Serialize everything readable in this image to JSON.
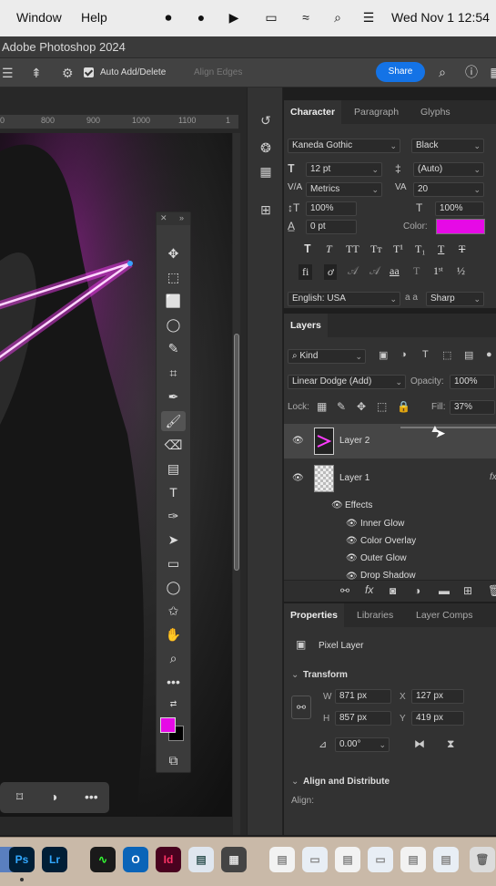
{
  "menubar": {
    "window": "Window",
    "help": "Help",
    "datetime": "Wed Nov 1  12:54"
  },
  "app_title": "Adobe Photoshop 2024",
  "options": {
    "auto_add_delete": "Auto Add/Delete",
    "align_edges": "Align Edges",
    "share": "Share"
  },
  "ruler": [
    "0",
    "800",
    "900",
    "1000",
    "1100",
    "1"
  ],
  "character": {
    "tabs": [
      "Character",
      "Paragraph",
      "Glyphs"
    ],
    "font_family": "Kaneda Gothic",
    "font_style": "Black",
    "font_size": "12 pt",
    "leading": "(Auto)",
    "kerning": "Metrics",
    "tracking": "20",
    "vscale": "100%",
    "hscale": "100%",
    "baseline": "0 pt",
    "color_label": "Color:",
    "color": "#e60ae6",
    "language": "English: USA",
    "aa_label": "a a",
    "antialias": "Sharp"
  },
  "layers": {
    "tab": "Layers",
    "filter": "Kind",
    "blend": "Linear Dodge (Add)",
    "opacity_label": "Opacity:",
    "opacity": "100%",
    "lock_label": "Lock:",
    "fill_label": "Fill:",
    "fill": "37%",
    "items": [
      {
        "name": "Layer 2"
      },
      {
        "name": "Layer 1",
        "fx": "fx"
      }
    ],
    "effects_label": "Effects",
    "effects": [
      "Inner Glow",
      "Color Overlay",
      "Outer Glow",
      "Drop Shadow"
    ]
  },
  "properties": {
    "tabs": [
      "Properties",
      "Libraries",
      "Layer Comps"
    ],
    "kind": "Pixel Layer",
    "transform": "Transform",
    "w_label": "W",
    "w": "871 px",
    "x_label": "X",
    "x": "127 px",
    "h_label": "H",
    "h": "857 px",
    "y_label": "Y",
    "y": "419 px",
    "angle": "0.00°",
    "align": "Align and Distribute",
    "align_label": "Align:"
  },
  "dock": {
    "ps": "Ps",
    "lr": "Lr",
    "id": "Id"
  }
}
